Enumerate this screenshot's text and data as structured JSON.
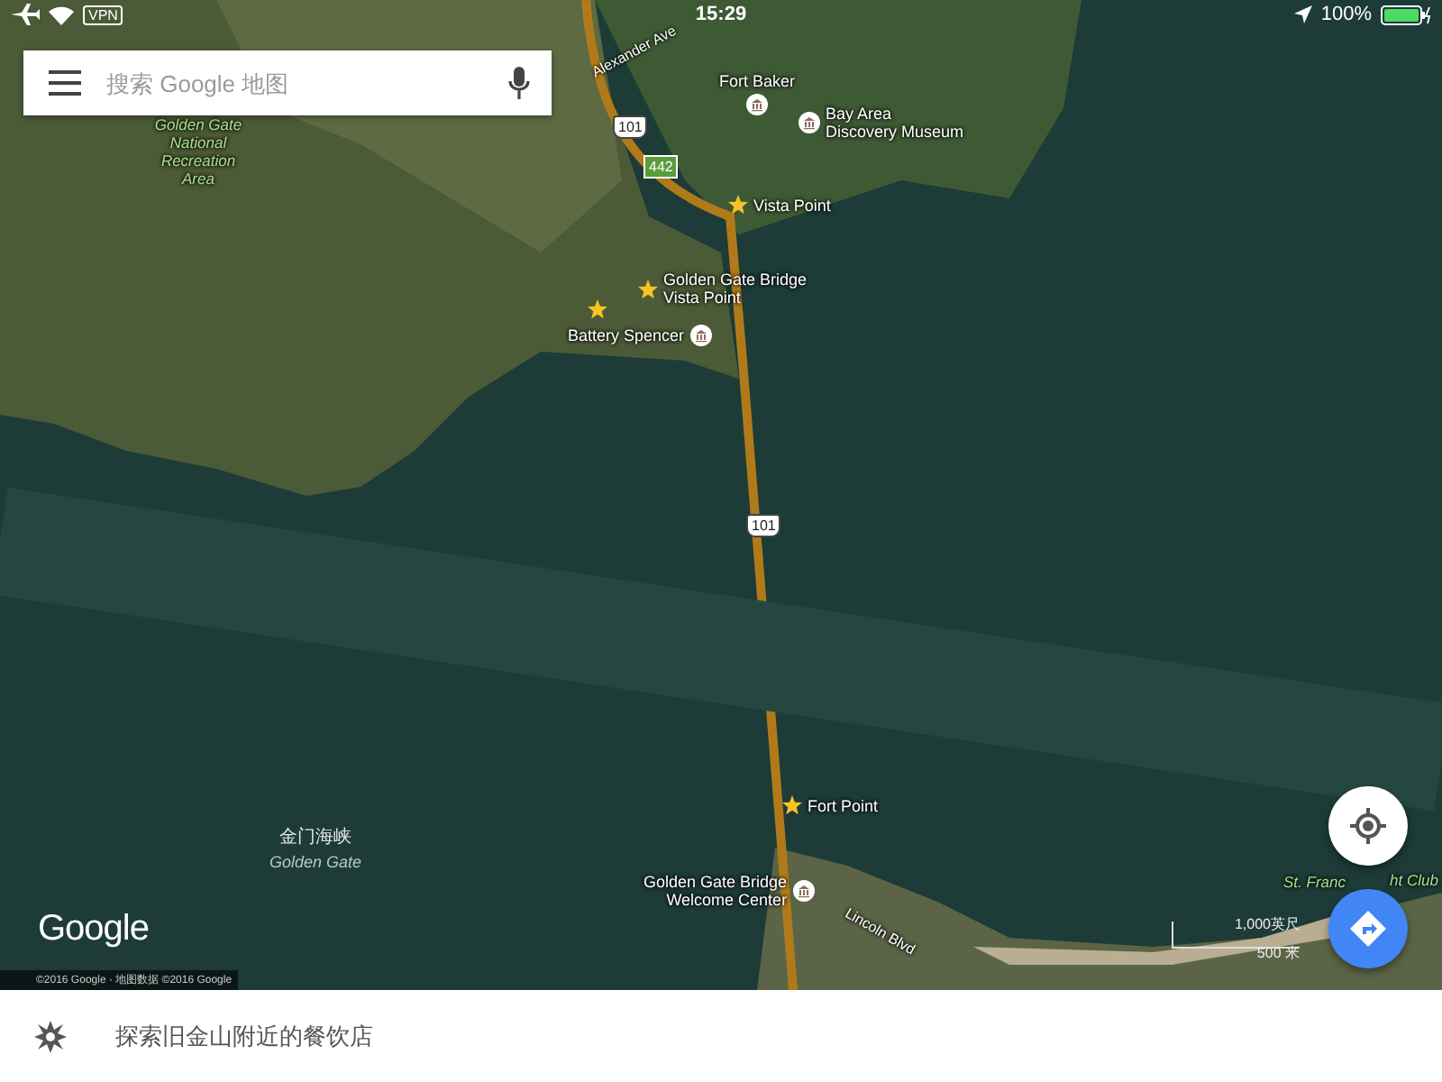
{
  "status_bar": {
    "vpn": "VPN",
    "time": "15:29",
    "battery": "100%"
  },
  "search": {
    "placeholder": "搜索 Google 地图"
  },
  "map": {
    "labels": [
      {
        "kind": "road",
        "lines": [
          "Alexander Ave"
        ]
      },
      {
        "kind": "place-icon-below",
        "lines": [
          "Fort Baker"
        ]
      },
      {
        "kind": "shield-us",
        "lines": [
          "101"
        ]
      },
      {
        "kind": "icon-before",
        "lines": [
          "Bay Area",
          "Discovery Museum"
        ]
      },
      {
        "kind": "shield-state",
        "lines": [
          "442"
        ]
      },
      {
        "kind": "star-place",
        "lines": [
          "Vista Point"
        ]
      },
      {
        "kind": "star-place",
        "lines": [
          "Golden Gate Bridge",
          "Vista Point"
        ]
      },
      {
        "kind": "star"
      },
      {
        "kind": "icon-after",
        "lines": [
          "Battery Spencer"
        ]
      },
      {
        "kind": "park",
        "lines": [
          "Golden Gate",
          "National",
          "Recreation",
          "Area"
        ]
      },
      {
        "kind": "shield-us",
        "lines": [
          "101"
        ]
      },
      {
        "kind": "star-place",
        "lines": [
          "Fort Point"
        ]
      },
      {
        "kind": "icon-after",
        "lines": [
          "Golden Gate Bridge",
          "Welcome Center"
        ]
      },
      {
        "kind": "road",
        "lines": [
          "Lincoln Blvd"
        ]
      },
      {
        "kind": "water",
        "lines": [
          "金门海峡"
        ]
      },
      {
        "kind": "water-latin",
        "lines": [
          "Golden Gate"
        ]
      },
      {
        "kind": "park",
        "lines": [
          "St. Franc"
        ]
      },
      {
        "kind": "park",
        "lines": [
          "ht Club"
        ]
      }
    ],
    "scale": {
      "imperial": "1,000英尺",
      "metric": "500 米"
    },
    "logo": "Google",
    "attribution": "©2016 Google · 地图数据 ©2016 Google"
  },
  "bottom_bar": {
    "text": "探索旧金山附近的餐饮店"
  }
}
